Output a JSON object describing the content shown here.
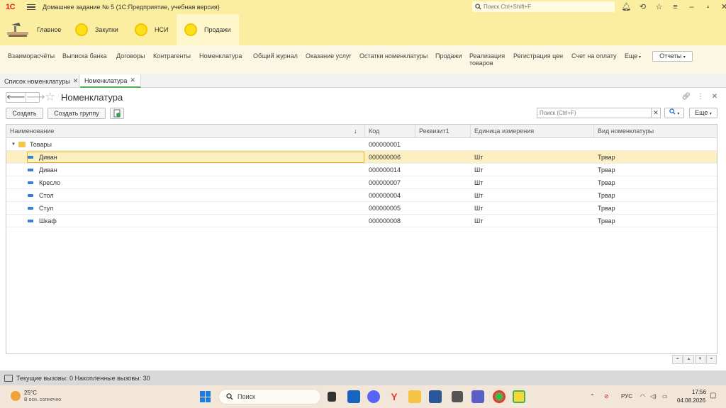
{
  "titlebar": {
    "logo": "1С",
    "app_title": "Домашнее задание № 5  (1С:Предприятие, учебная версия)",
    "search_placeholder": "Поиск Ctrl+Shift+F"
  },
  "sections": [
    {
      "label": "Главное",
      "icon": "home-desk-icon"
    },
    {
      "label": "Закупки",
      "icon": "yellow-circle-icon"
    },
    {
      "label": "НСИ",
      "icon": "yellow-circle-icon"
    },
    {
      "label": "Продажи",
      "icon": "yellow-circle-icon",
      "active": true
    }
  ],
  "functions": [
    "Взаиморасчёты",
    "Выписка банка",
    "Договоры",
    "Контрагенты",
    "Номенклатура",
    "Общий журнал",
    "Оказание услуг",
    "Остатки номенклатуры",
    "Продажи",
    "Реализация товаров",
    "Регистрация цен",
    "Счет на оплату",
    "Еще"
  ],
  "reports_label": "Отчеты",
  "tabs": [
    {
      "label": "Список номенклатуры",
      "active": false
    },
    {
      "label": "Номенклатура",
      "active": true
    }
  ],
  "form": {
    "title": "Номенклатура",
    "create_label": "Создать",
    "create_group_label": "Создать группу",
    "search_placeholder": "Поиск (Ctrl+F)",
    "more_label": "Еще"
  },
  "table": {
    "columns": [
      "Наименование",
      "Код",
      "Реквизит1",
      "Единица измерения",
      "Вид номенклатуры"
    ],
    "group": {
      "name": "Товары",
      "code": "000000001"
    },
    "rows": [
      {
        "name": "Диван",
        "code": "000000006",
        "attr1": "",
        "unit": "Шт",
        "kind": "Трвар",
        "selected": true
      },
      {
        "name": "Диван",
        "code": "000000014",
        "attr1": "",
        "unit": "Шт",
        "kind": "Трвар"
      },
      {
        "name": "Кресло",
        "code": "000000007",
        "attr1": "",
        "unit": "Шт",
        "kind": "Трвар"
      },
      {
        "name": "Стол",
        "code": "000000004",
        "attr1": "",
        "unit": "Шт",
        "kind": "Трвар"
      },
      {
        "name": "Стул",
        "code": "000000005",
        "attr1": "",
        "unit": "Шт",
        "kind": "Трвар"
      },
      {
        "name": "Шкаф",
        "code": "000000008",
        "attr1": "",
        "unit": "Шт",
        "kind": "Трвар"
      }
    ]
  },
  "statusbar": {
    "text": "Текущие вызовы: 0   Накопленные вызовы: 30"
  },
  "taskbar": {
    "temperature": "25°C",
    "weather": "В осн. солнечно",
    "search_label": "Поиск",
    "language": "РУС",
    "time": "17:56",
    "date": "04.08.2026"
  },
  "colors": {
    "panel_yellow": "#fbeea0",
    "selection": "#fcefc2",
    "active_tab_accent": "#4caf50"
  }
}
